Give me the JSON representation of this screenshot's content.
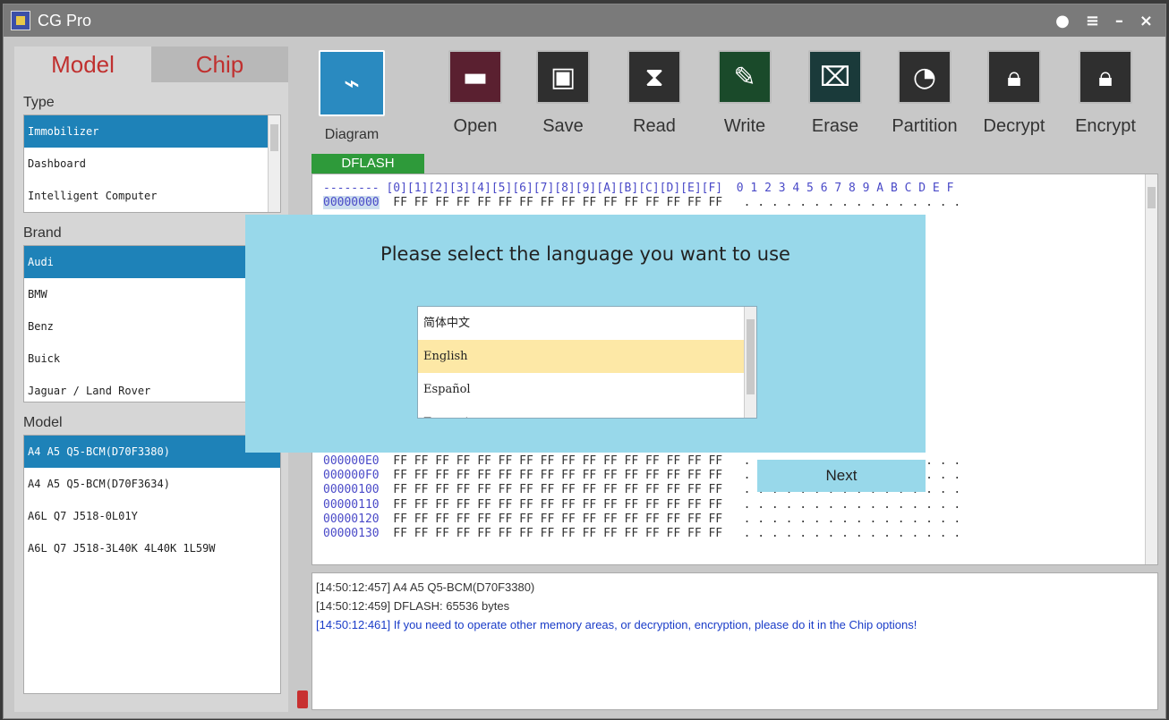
{
  "app": {
    "title": "CG Pro"
  },
  "left": {
    "tabs": [
      "Model",
      "Chip"
    ],
    "type": {
      "label": "Type",
      "items": [
        "Immobilizer",
        "Dashboard",
        "Intelligent Computer"
      ],
      "selected": 0
    },
    "brand": {
      "label": "Brand",
      "items": [
        "Audi",
        "BMW",
        "Benz",
        "Buick",
        "Jaguar / Land Rover"
      ],
      "selected": 0
    },
    "model": {
      "label": "Model",
      "items": [
        "A4 A5 Q5-BCM(D70F3380)",
        "A4 A5 Q5-BCM(D70F3634)",
        "A6L Q7 J518-0L01Y",
        "A6L Q7 J518-3L40K 4L40K 1L59W"
      ],
      "selected": 0
    }
  },
  "toolbar": {
    "items": [
      {
        "label": "Diagram",
        "icon": "diagram-icon"
      },
      {
        "label": "Open",
        "icon": "folder-icon"
      },
      {
        "label": "Save",
        "icon": "floppy-icon"
      },
      {
        "label": "Read",
        "icon": "hourglass-icon"
      },
      {
        "label": "Write",
        "icon": "pencil-icon"
      },
      {
        "label": "Erase",
        "icon": "eraser-icon"
      },
      {
        "label": "Partition",
        "icon": "pie-icon"
      },
      {
        "label": "Decrypt",
        "icon": "lock-icon"
      },
      {
        "label": "Encrypt",
        "icon": "lock-gear-icon"
      }
    ],
    "dflash_label": "DFLASH"
  },
  "hex": {
    "header": "-------- [0][1][2][3][4][5][6][7][8][9][A][B][C][D][E][F]  0 1 2 3 4 5 6 7 8 9 A B C D E F",
    "top_rows": [
      "00000000"
    ],
    "bottom_rows": [
      "000000E0",
      "000000F0",
      "00000100",
      "00000110",
      "00000120",
      "00000130"
    ],
    "byte": "FF"
  },
  "log": {
    "lines": [
      "[14:50:12:457]  A4  A5  Q5-BCM(D70F3380)",
      "[14:50:12:459]  DFLASH:  65536  bytes",
      "[14:50:12:461]  If  you  need  to  operate  other  memory  areas,  or  decryption,  encryption,  please  do  it  in  the  Chip  options!"
    ]
  },
  "modal": {
    "title": "Please select the language you want to use",
    "languages": [
      "简体中文",
      "English",
      "Español",
      "Français"
    ],
    "selected": 1,
    "next_label": "Next"
  },
  "colors": {
    "accent": "#1e82b8",
    "modal_bg": "#98d8ea",
    "tab_text": "#c0302f",
    "dflash_bg": "#2e9a3a"
  }
}
